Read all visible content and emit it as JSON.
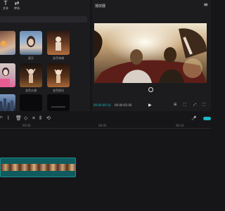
{
  "left_panel": {
    "tabs": [
      {
        "icon": "text-icon",
        "glyph": "T",
        "label": "文本"
      },
      {
        "icon": "transition-icon",
        "glyph": "⇄",
        "label": "转场"
      }
    ],
    "media": [
      {
        "caption": ""
      },
      {
        "caption": "夏天"
      },
      {
        "caption": "金色海滩"
      },
      {
        "caption": ""
      },
      {
        "caption": "金色沙滩"
      },
      {
        "caption": "金色阳光"
      },
      {
        "caption": ""
      },
      {
        "caption": ""
      },
      {
        "caption": ""
      }
    ]
  },
  "player": {
    "title": "播放器",
    "menu": "≡",
    "timecode_current": "00:00:00:14",
    "timecode_total": "00:00:05:00",
    "play": "▶",
    "controls": [
      "⊞",
      "⛶",
      "⤢",
      "⛶"
    ]
  },
  "toolbar": {
    "items": [
      {
        "icon": "undo-icon",
        "glyph": "↶"
      },
      {
        "icon": "split-icon",
        "glyph": "⌇"
      },
      {
        "icon": "delete-icon",
        "glyph": "🗑"
      },
      {
        "icon": "freeze-icon",
        "glyph": "◇"
      },
      {
        "icon": "crop-icon",
        "glyph": "⌗"
      },
      {
        "icon": "mirror-icon",
        "glyph": "⫴"
      },
      {
        "icon": "rotate-icon",
        "glyph": "⟲"
      }
    ],
    "mic": "🎤"
  },
  "timeline": {
    "ticks": [
      "00:00",
      "00:05",
      "00:10"
    ]
  }
}
